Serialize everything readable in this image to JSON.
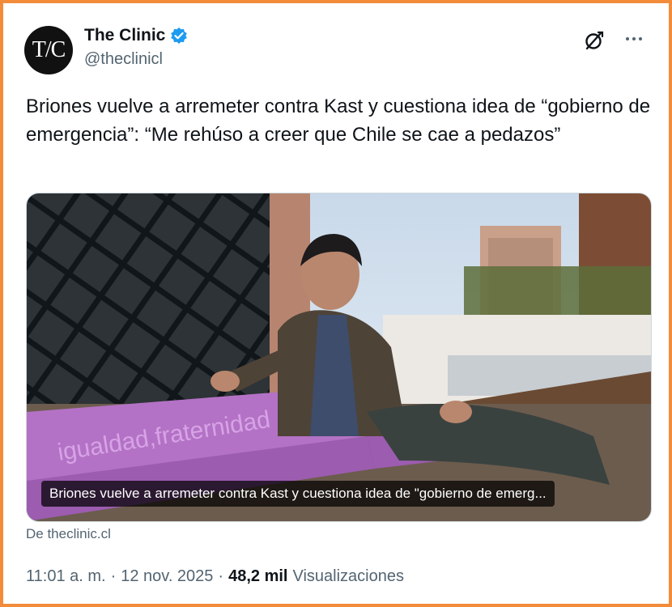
{
  "header": {
    "avatar_text": "T/C",
    "name": "The Clinic",
    "handle": "@theclinicl",
    "verified_icon": "verified-badge-icon",
    "grok_icon": "grok-slash-icon",
    "more_icon": "more-options-icon"
  },
  "tweet": {
    "text": "Briones vuelve a arremeter contra Kast y cuestiona idea de “gobierno de emergencia”: “Me rehúso a creer que Chile se cae a pedazos”",
    "media_caption": "Briones vuelve a arremeter contra Kast y cuestiona idea de \"gobierno de emerg...",
    "bench_engraving": "igualdad,fraternidad",
    "source": "De theclinic.cl"
  },
  "meta": {
    "time": "11:01 a. m.",
    "date": "12 nov. 2025",
    "views_count": "48,2 mil",
    "views_label": "Visualizaciones"
  },
  "colors": {
    "frame_border": "#f28c3a",
    "verified_blue": "#1d9bf0",
    "secondary_text": "#536471"
  }
}
